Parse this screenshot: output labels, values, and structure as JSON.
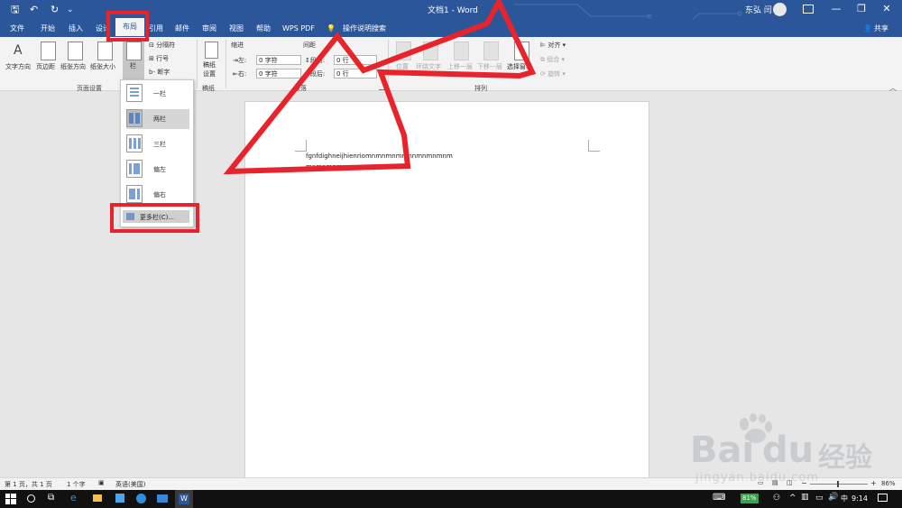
{
  "titlebar": {
    "doc_title": "文档1 - Word",
    "user_name": "东弘 闫",
    "save_glyph": "🖫",
    "undo_glyph": "↶",
    "redo_glyph": "↻",
    "customize_glyph": "⌄",
    "minimize_glyph": "—",
    "restore_glyph": "❐",
    "close_glyph": "✕"
  },
  "tabs": [
    "文件",
    "开始",
    "插入",
    "设计",
    "布局",
    "引用",
    "邮件",
    "审阅",
    "视图",
    "帮助",
    "WPS PDF"
  ],
  "tell_me": "操作说明搜索",
  "share": "共享",
  "ribbon": {
    "page_setup": {
      "text_direction": "文字方向",
      "margins": "页边距",
      "orientation": "纸张方向",
      "size": "纸张大小",
      "columns": "栏",
      "breaks": "分隔符",
      "line_numbers": "行号",
      "hyphenation": "断字",
      "group_label": "页面设置"
    },
    "manuscript": {
      "label_line1": "稿纸",
      "label_line2": "设置",
      "group_label": "稿纸"
    },
    "paragraph": {
      "indent_header": "缩进",
      "spacing_header": "间距",
      "indent_left_label": "左:",
      "indent_left_value": "0 字符",
      "indent_right_label": "右:",
      "indent_right_value": "0 字符",
      "spacing_before_label": "段前:",
      "spacing_before_value": "0 行",
      "spacing_after_label": "段后:",
      "spacing_after_value": "0 行",
      "group_label": "段落"
    },
    "arrange": {
      "position": "位置",
      "wrap_text": "环绕文字",
      "bring_forward": "上移一层",
      "send_backward": "下移一层",
      "selection_pane": "选择窗格",
      "align": "对齐",
      "group": "组合",
      "rotate": "旋转",
      "group_label": "排列"
    }
  },
  "columns_menu": {
    "items": [
      "一栏",
      "两栏",
      "三栏",
      "偏左",
      "偏右"
    ],
    "more": "更多栏(C)..."
  },
  "document": {
    "line1": "fgnfdighneijhienriomnmnmnmnmnmnmnmnm",
    "line2": "mnmnmnmnmnmnmnm"
  },
  "statusbar": {
    "page": "第 1 页，共 1 页",
    "words": "1 个字",
    "language": "英语(美国)",
    "zoom": "86%",
    "zoom_minus": "−",
    "zoom_plus": "+"
  },
  "taskbar": {
    "battery": "81%",
    "time": "9:14",
    "ime": "中"
  },
  "watermark": {
    "brand": "Bai",
    "brand2": "du",
    "cn": "经验",
    "url": "jingyan.baidu.com"
  },
  "colors": {
    "word_blue": "#2b579a",
    "annotation_red": "#e8232b"
  }
}
